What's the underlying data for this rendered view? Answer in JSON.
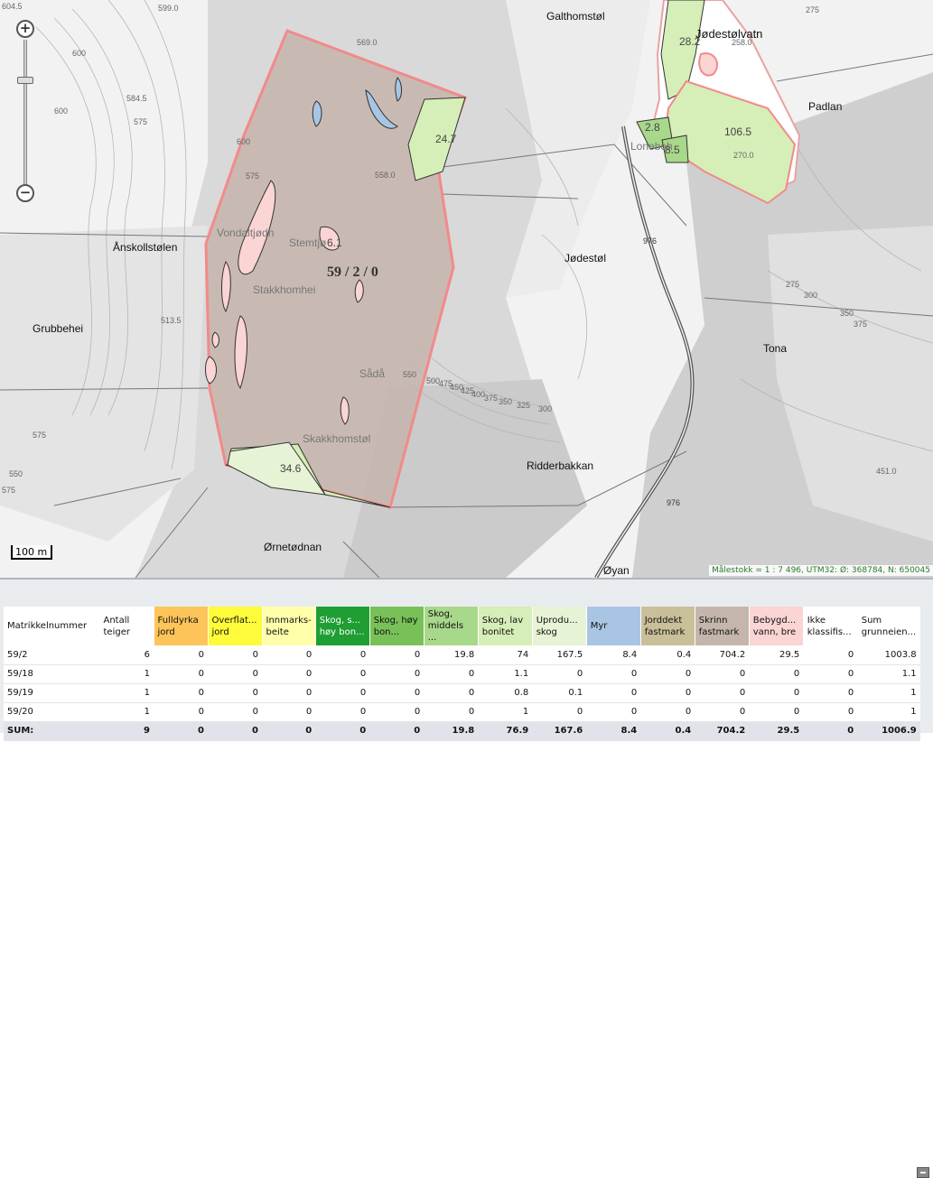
{
  "map": {
    "place_labels": [
      "Galthomstøl",
      "Jødestølvatn",
      "Padlan",
      "Ånskollstølen",
      "Grubbehei",
      "Jødestøl",
      "Stemtjø",
      "Stakkhomhei",
      "Vondaltjødn",
      "Lonebeh",
      "Sådå",
      "Skakkhomstøl",
      "Tona",
      "Ridderbakkan",
      "Ørnetødnan",
      "Øyan"
    ],
    "parcel_label": "59 / 2 / 0",
    "area_labels": [
      "24.7",
      "106.5",
      "28.2",
      "2.8",
      "8.5",
      "6.1",
      "34.6"
    ],
    "elevation_labels": [
      "599.0",
      "569.0",
      "584.5",
      "558.0",
      "600",
      "600",
      "600",
      "604.5",
      "575",
      "575",
      "513.5",
      "550",
      "575",
      "500",
      "475",
      "450",
      "425",
      "400",
      "375",
      "350",
      "325",
      "300",
      "258.0",
      "270.0",
      "275",
      "300",
      "350",
      "375",
      "451.0",
      "550",
      "275",
      "575"
    ],
    "road_labels": [
      "976",
      "976"
    ],
    "scale_bar": "100 m",
    "scale_info": "Målestokk = 1 : 7 496, UTM32: Ø: 368784, N: 650045",
    "zoom_in": "+",
    "zoom_out": "−"
  },
  "colors": {
    "Fulldyrka jord": "#fdc45a",
    "Overflatedyrka jord": "#fefb3a",
    "Innmarksbeite": "#ffffaa",
    "Skog, særs høy bonitet": "#1f9e33",
    "Skog, høy bonitet": "#78c158",
    "Skog, middels bonitet": "#a8d88a",
    "Skog, lav bonitet": "#d6eeb8",
    "Uproduktiv skog": "#e7f3d5",
    "Myr": "#a9c5e4",
    "Jorddekt fastmark": "#c9bf99",
    "Skrinn fastmark": "#c5b6ad",
    "Bebygd, samferdsel, vann, bre": "#fbd4d4",
    "Ikke klassifisert": "#ffffff",
    "parcel_outline": "#f28a8a"
  },
  "table": {
    "headers": [
      {
        "label": "Matrikkelnummer",
        "color": "#ffffff"
      },
      {
        "label": "Antall teiger",
        "color": "#ffffff"
      },
      {
        "label": "Fulldyrka jord",
        "color": "#fdc45a"
      },
      {
        "label": "Overflat... jord",
        "color": "#fefb3a"
      },
      {
        "label": "Innmarks-beite",
        "color": "#ffffaa"
      },
      {
        "label": "Skog, s... høy bon...",
        "color": "#1f9e33"
      },
      {
        "label": "Skog, høy bon...",
        "color": "#78c158"
      },
      {
        "label": "Skog, middels ...",
        "color": "#a8d88a"
      },
      {
        "label": "Skog, lav bonitet",
        "color": "#d6eeb8"
      },
      {
        "label": "Uprodu... skog",
        "color": "#e7f3d5"
      },
      {
        "label": "Myr",
        "color": "#a9c5e4"
      },
      {
        "label": "Jorddekt fastmark",
        "color": "#c9bf99"
      },
      {
        "label": "Skrinn fastmark",
        "color": "#c5b6ad"
      },
      {
        "label": "Bebygd... vann, bre",
        "color": "#fbd4d4"
      },
      {
        "label": "Ikke klassifis...",
        "color": "#ffffff"
      },
      {
        "label": "Sum grunneien...",
        "color": "#ffffff"
      }
    ],
    "rows": [
      [
        "59/2",
        "6",
        "0",
        "0",
        "0",
        "0",
        "0",
        "19.8",
        "74",
        "167.5",
        "8.4",
        "0.4",
        "704.2",
        "29.5",
        "0",
        "1003.8"
      ],
      [
        "59/18",
        "1",
        "0",
        "0",
        "0",
        "0",
        "0",
        "0",
        "1.1",
        "0",
        "0",
        "0",
        "0",
        "0",
        "0",
        "1.1"
      ],
      [
        "59/19",
        "1",
        "0",
        "0",
        "0",
        "0",
        "0",
        "0",
        "0.8",
        "0.1",
        "0",
        "0",
        "0",
        "0",
        "0",
        "1"
      ],
      [
        "59/20",
        "1",
        "0",
        "0",
        "0",
        "0",
        "0",
        "0",
        "1",
        "0",
        "0",
        "0",
        "0",
        "0",
        "0",
        "1"
      ]
    ],
    "sum_row": [
      "SUM:",
      "9",
      "0",
      "0",
      "0",
      "0",
      "0",
      "19.8",
      "76.9",
      "167.6",
      "8.4",
      "0.4",
      "704.2",
      "29.5",
      "0",
      "1006.9"
    ]
  }
}
